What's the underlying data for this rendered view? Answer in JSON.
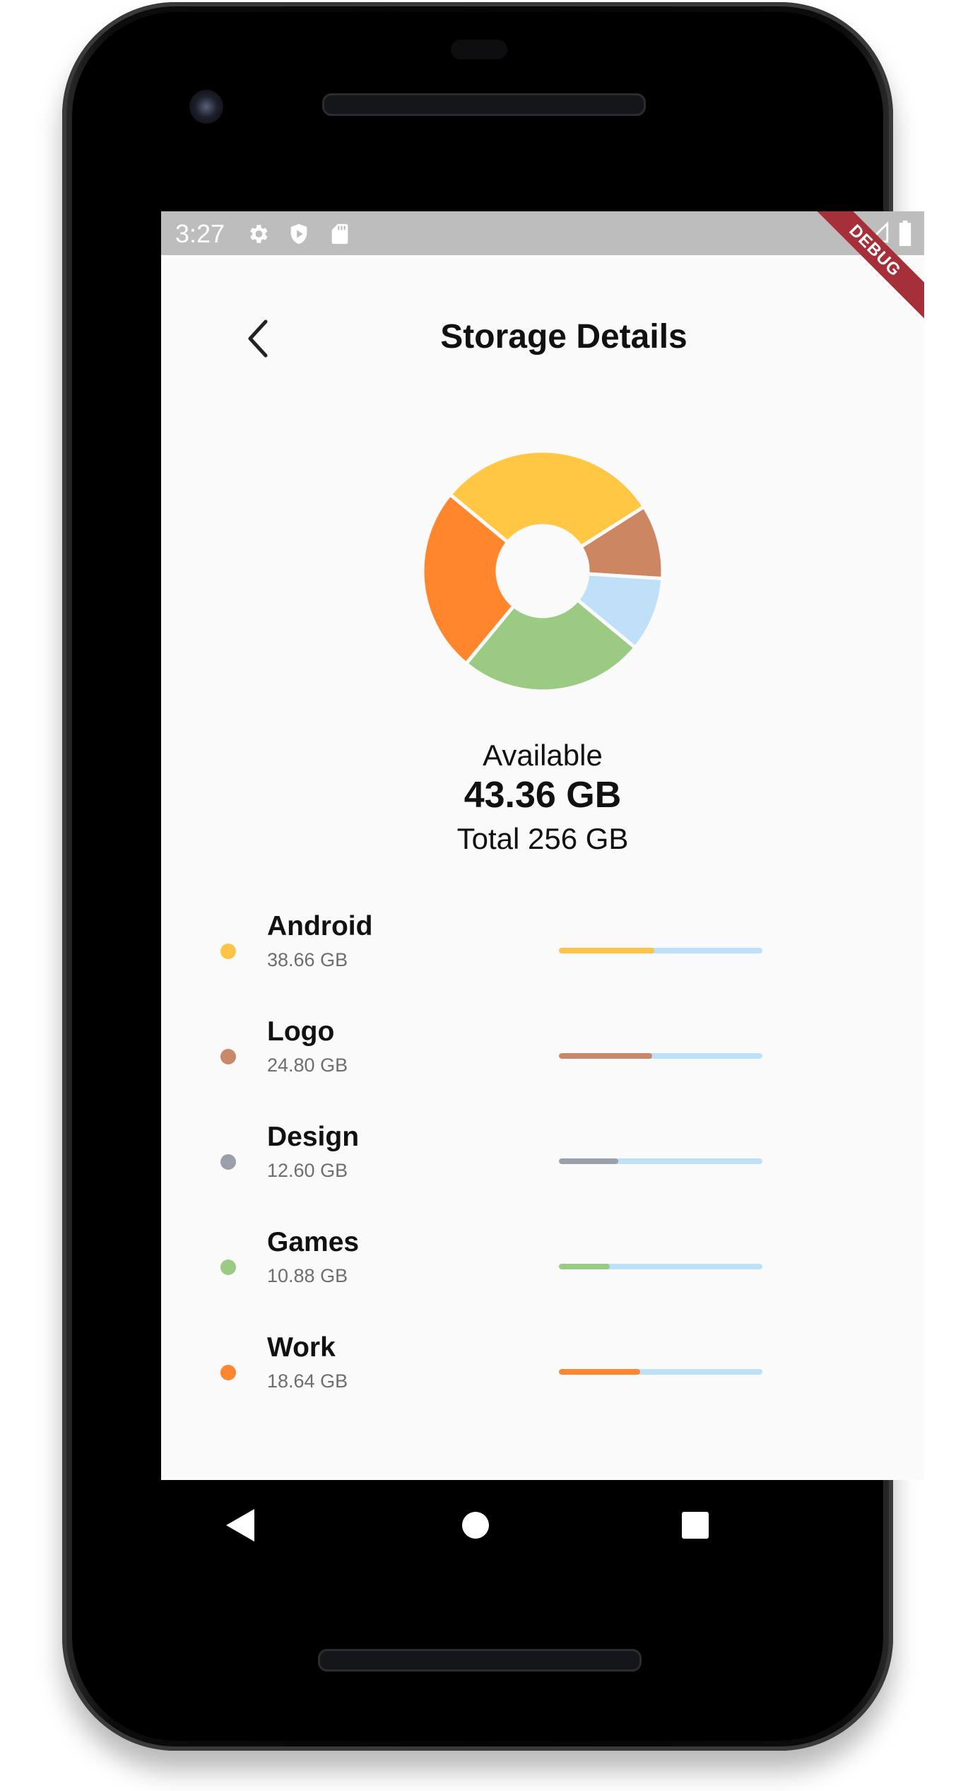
{
  "status_bar": {
    "time": "3:27",
    "left_icons": [
      "gear-icon",
      "shield-play-icon",
      "sd-card-icon"
    ],
    "right_icons": [
      "wifi-icon",
      "signal-icon",
      "battery-icon"
    ],
    "debug_banner": "DEBUG"
  },
  "header": {
    "back_icon": "chevron-left-icon",
    "title": "Storage Details"
  },
  "chart_data": {
    "type": "pie",
    "style": "donut",
    "categories": [
      "Android",
      "Logo",
      "Design",
      "Games",
      "Work"
    ],
    "values": [
      38.66,
      24.8,
      12.6,
      10.88,
      18.64
    ],
    "segments_displayed": [
      {
        "color": "#ffc744",
        "share": 0.3
      },
      {
        "color": "#cc8662",
        "share": 0.1
      },
      {
        "color": "#c0e0f8",
        "share": 0.1
      },
      {
        "color": "#9bcb83",
        "share": 0.25
      },
      {
        "color": "#ff862d",
        "share": 0.25
      }
    ]
  },
  "summary": {
    "label": "Available",
    "value": "43.36 GB",
    "total": "Total 256 GB"
  },
  "storage_items": [
    {
      "name": "Android",
      "size": "38.66 GB",
      "color": "#fdc445",
      "progress": 0.47
    },
    {
      "name": "Logo",
      "size": "24.80 GB",
      "color": "#c7896a",
      "progress": 0.46
    },
    {
      "name": "Design",
      "size": "12.60 GB",
      "color": "#9aa0a9",
      "progress": 0.29
    },
    {
      "name": "Games",
      "size": "10.88 GB",
      "color": "#9acb85",
      "progress": 0.25
    },
    {
      "name": "Work",
      "size": "18.64 GB",
      "color": "#fe862e",
      "progress": 0.4
    }
  ],
  "colors": {
    "track": "#bee0f9",
    "background": "#fafafa",
    "status_bar": "#bdbdbd"
  },
  "nav_bar": {
    "icons": [
      "back-triangle-icon",
      "home-circle-icon",
      "recents-square-icon"
    ]
  }
}
